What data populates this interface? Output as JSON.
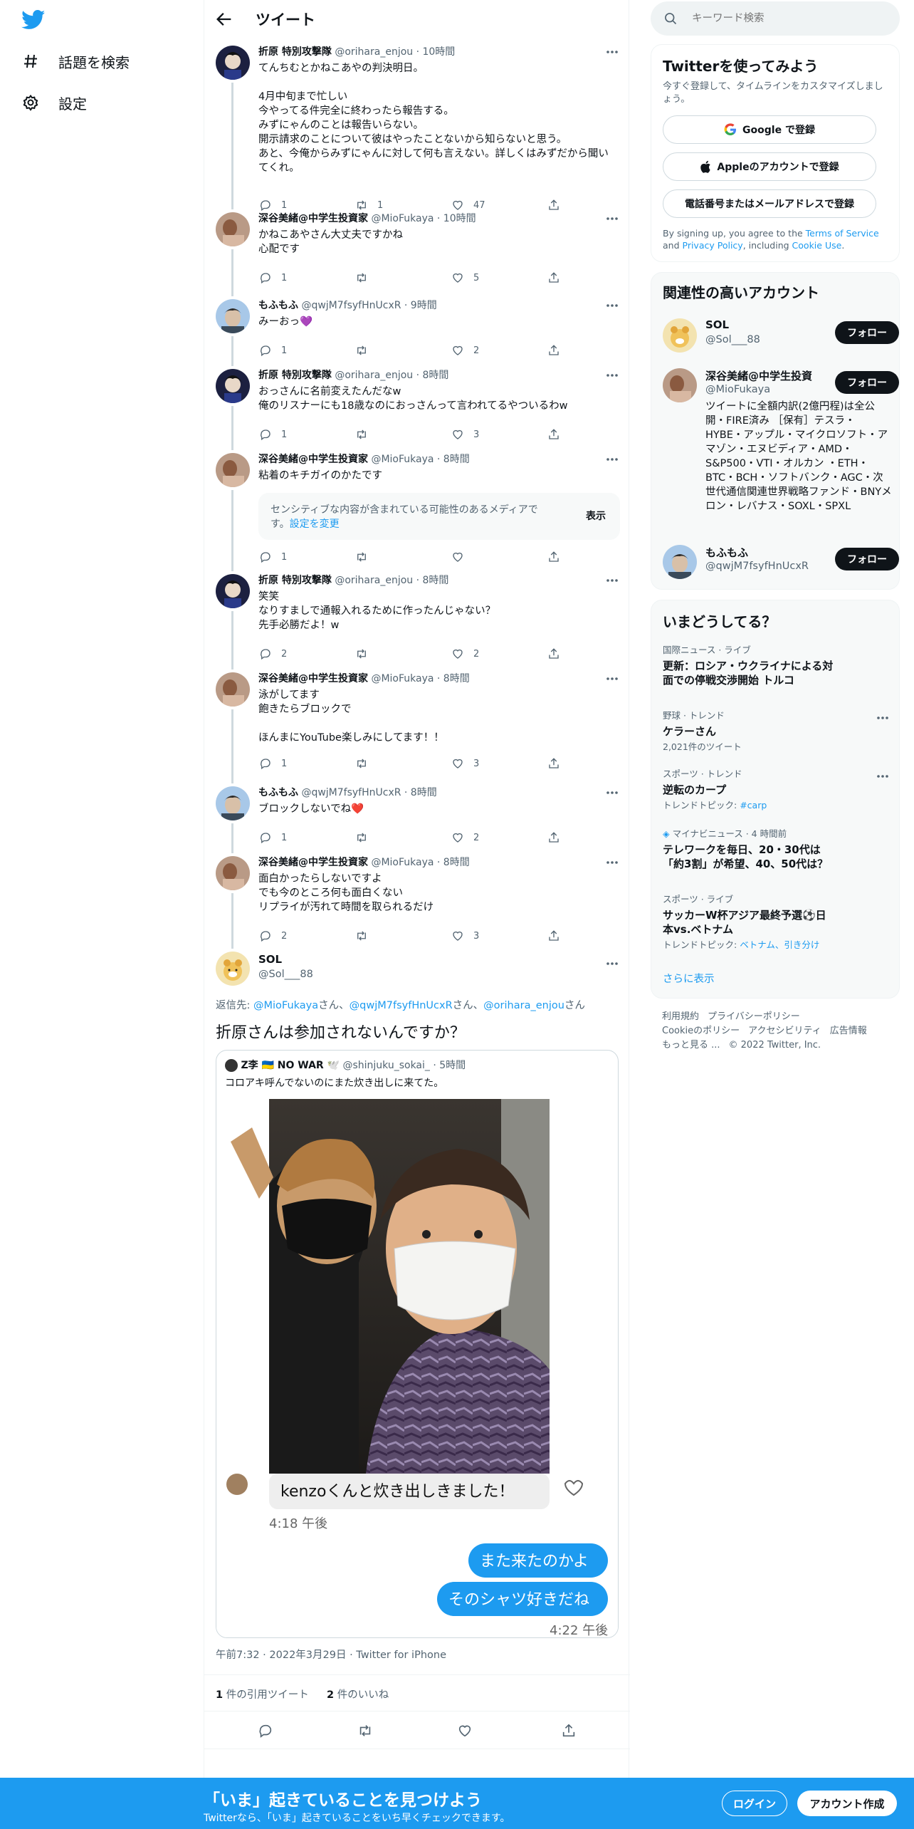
{
  "nav": {
    "explore_label": "話題を検索",
    "settings_label": "設定"
  },
  "header": {
    "title": "ツイート"
  },
  "thread": [
    {
      "name": "折原 特別攻撃隊",
      "meta": "@orihara_enjou · 10時間",
      "body": "てんちむとかねこあやの判決明日。\n\n4月中旬まで忙しい\n今やってる件完全に終わったら報告する。\nみずにゃんのことは報告いらない。\n開示請求のことについて彼はやったことないから知らないと思う。\nあと、今俺からみずにゃんに対して何も言えない。詳しくはみずだから聞いてくれ。",
      "replies": "1",
      "retweets": "1",
      "likes": "47"
    },
    {
      "name": "深谷美緒@中学生投資家",
      "meta": "@MioFukaya · 10時間",
      "body": "かねこあやさん大丈夫ですかね\n心配です",
      "replies": "1",
      "retweets": "",
      "likes": "5"
    },
    {
      "name": "もふもふ",
      "meta": "@qwjM7fsyfHnUcxR · 9時間",
      "body": "みーおっ💜",
      "replies": "1",
      "retweets": "",
      "likes": "2"
    },
    {
      "name": "折原 特別攻撃隊",
      "meta": "@orihara_enjou · 8時間",
      "body": "おっさんに名前変えたんだなw\n俺のリスナーにも18歳なのにおっさんって言われてるやついるわw",
      "replies": "1",
      "retweets": "",
      "likes": "3"
    },
    {
      "name": "深谷美緒@中学生投資家",
      "meta": "@MioFukaya · 8時間",
      "body": "粘着のキチガイのかたです",
      "replies": "1",
      "retweets": "",
      "likes": ""
    },
    {
      "name": "折原 特別攻撃隊",
      "meta": "@orihara_enjou · 8時間",
      "body": "笑笑\nなりすましで通報入れるために作ったんじゃない？\n先手必勝だよ！w",
      "replies": "2",
      "retweets": "",
      "likes": "2"
    },
    {
      "name": "深谷美緒@中学生投資家",
      "meta": "@MioFukaya · 8時間",
      "body": "泳がしてます\n飽きたらブロックで\n\nほんまにYouTube楽しみにしてます！！",
      "replies": "1",
      "retweets": "",
      "likes": "3"
    },
    {
      "name": "もふもふ",
      "meta": "@qwjM7fsyfHnUcxR · 8時間",
      "body": "ブロックしないでね❤️",
      "replies": "1",
      "retweets": "",
      "likes": "2"
    },
    {
      "name": "深谷美緒@中学生投資家",
      "meta": "@MioFukaya · 8時間",
      "body": "面白かったらしないですよ\nでも今のところ何も面白くない\nリプライが汚れて時間を取られるだけ",
      "replies": "2",
      "retweets": "",
      "likes": "3"
    }
  ],
  "sensitive": {
    "text": "センシティブな内容が含まれている可能性のあるメディアです。",
    "link": "設定を変更",
    "show": "表示"
  },
  "focal": {
    "name": "SOL",
    "handle": "@Sol___88",
    "replying_prefix": "返信先: ",
    "mention1": "@MioFukaya",
    "mention2": "@qwjM7fsyfHnUcxR",
    "mention3": "@orihara_enjou",
    "san": "さん",
    "sep": "、",
    "text": "折原さんは参加されないんですか？",
    "meta": "午前7:32 · 2022年3月29日 · Twitter for iPhone",
    "quote_count": "1",
    "quote_label": "件の引用ツイート",
    "like_count": "2",
    "like_label": "件のいいね"
  },
  "quote": {
    "name": "Z李 🇺🇦 NO WAR 🕊️",
    "meta": "@shinjuku_sokai_ · 5時間",
    "body": "コロアキ呼んでないのにまた炊き出しに来てた。",
    "chat_incoming": "kenzoくんと炊き出しきました！",
    "chat_time1": "4:18 午後",
    "chat_out1": "また来たのかよ",
    "chat_out2": "そのシャツ好きだね",
    "chat_time2": "4:22 午後"
  },
  "search": {
    "placeholder": "キーワード検索"
  },
  "signup": {
    "title": "Twitterを使ってみよう",
    "subtitle": "今すぐ登録して、タイムラインをカスタマイズしましょう。",
    "google": "Google で登録",
    "apple": "Appleのアカウントで登録",
    "phone": "電話番号またはメールアドレスで登録",
    "legal_prefix": "By signing up, you agree to the ",
    "terms": "Terms of Service",
    "and": " and ",
    "privacy": "Privacy Policy",
    "including": ", including ",
    "cookie": "Cookie Use",
    "period": "."
  },
  "related": {
    "title": "関連性の高いアカウント",
    "follow": "フォロー",
    "accounts": [
      {
        "name": "SOL",
        "handle": "@Sol___88",
        "bio": ""
      },
      {
        "name": "深谷美緒@中学生投資家",
        "handle": "@MioFukaya",
        "bio": "ツイートに全額内訳(2億円程)は全公開・FIRE済み ［保有］テスラ・HYBE・アップル・マイクロソフト・アマゾン・エヌビディア・AMD・S&P500・VTI・オルカン ・ETH・BTC・BCH・ソフトバンク・AGC・次世代通信関連世界戦略ファンド・BNYメロン・レバナス・SOXL・SPXL"
      },
      {
        "name": "もふもふ",
        "handle": "@qwjM7fsyfHnUcxR",
        "bio": ""
      }
    ]
  },
  "trends": {
    "title": "いまどうしてる？",
    "items": [
      {
        "context": "国際ニュース · ライブ",
        "title": "更新：ロシア・ウクライナによる対面での停戦交渉開始 トルコ",
        "count": "",
        "links": ""
      },
      {
        "context": "野球 · トレンド",
        "title": "ケラーさん",
        "count": "2,021件のツイート",
        "links": ""
      },
      {
        "context": "スポーツ · トレンド",
        "title": "逆転のカープ",
        "count": "トレンドトピック: ",
        "links": "#carp"
      },
      {
        "context": "マイナビニュース · 4 時間前",
        "title": "テレワークを毎日、20・30代は「約3割」が希望、40、50代は？",
        "count": "",
        "links": ""
      },
      {
        "context": "スポーツ · ライブ",
        "title": "サッカーW杯アジア最終予選⚽日本vs.ベトナム",
        "count": "トレンドトピック: ",
        "links": "ベトナム、引き分け"
      }
    ],
    "show_more": "さらに表示"
  },
  "footer": {
    "terms": "利用規約",
    "privacy": "プライバシーポリシー",
    "cookie": "Cookieのポリシー",
    "access": "アクセシビリティ",
    "ads": "広告情報",
    "more": "もっと見る ...",
    "copy": "© 2022 Twitter, Inc."
  },
  "bottom_bar": {
    "title": "「いま」起きていることを見つけよう",
    "subtitle": "Twitterなら、「いま」起きていることをいち早くチェックできます。",
    "login": "ログイン",
    "signup": "アカウント作成"
  },
  "colors": {
    "accent": "#1d9bf0",
    "text": "#0f1419",
    "muted": "#536471",
    "border": "#eff3f4"
  }
}
